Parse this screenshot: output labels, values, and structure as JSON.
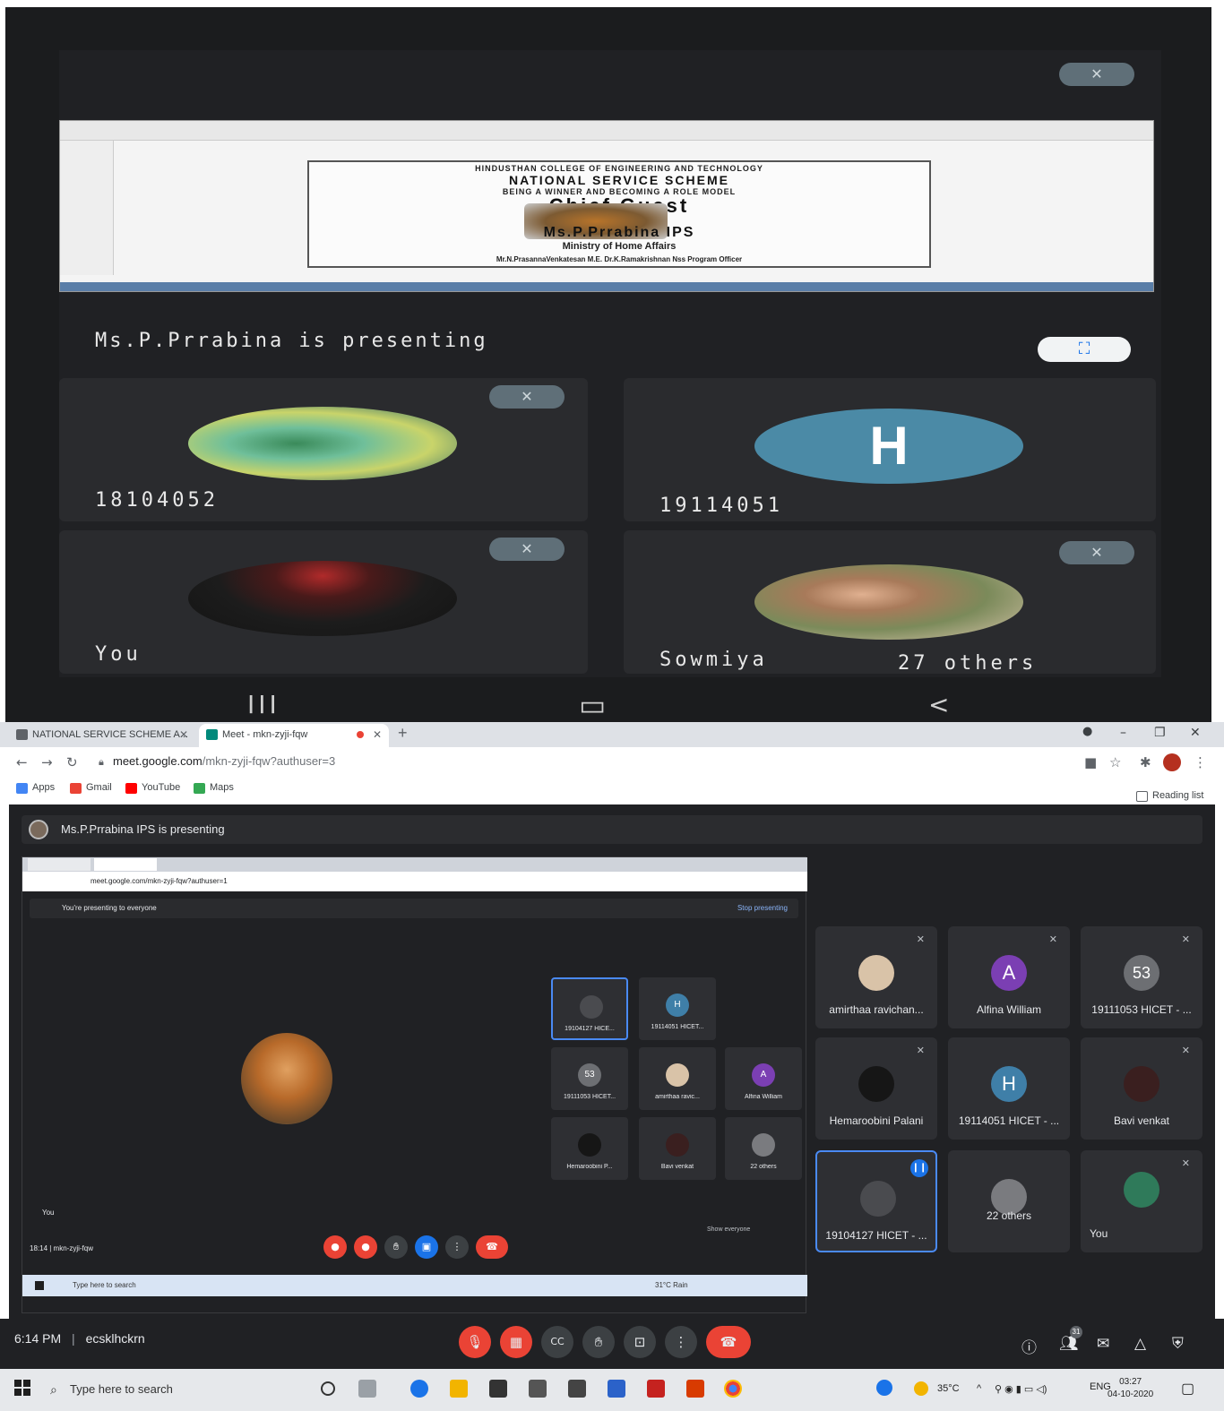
{
  "phone_view": {
    "presenting_text": "Ms.P.Prrabina is presenting",
    "shared_poster": {
      "line1": "HINDUSTHAN COLLEGE OF ENGINEERING AND TECHNOLOGY",
      "line2": "NATIONAL SERVICE SCHEME",
      "line3": "BEING A WINNER AND BECOMING A ROLE MODEL",
      "line4": "Chief Guest",
      "line5": "Ms.P.Prrabina IPS",
      "line6": "Ministry of Home Affairs",
      "line7": "Mr.N.PrasannaVenkatesan M.E.  Dr.K.Ramakrishnan  Nss Program Officer"
    },
    "tiles": [
      {
        "name": "18104052",
        "avatar": "photo-leaves"
      },
      {
        "name": "19114051",
        "initial": "H"
      },
      {
        "name": "You",
        "avatar": "photo-dark"
      },
      {
        "name": "Sowmiya",
        "extra": "27 others",
        "avatar": "photo-child"
      }
    ],
    "nav": {
      "recents": "III",
      "home": "▭",
      "back": "<"
    }
  },
  "browser": {
    "tabs": [
      {
        "title": "NATIONAL SERVICE SCHEME A...",
        "active": false
      },
      {
        "title": "Meet - mkn-zyji-fqw",
        "active": true
      }
    ],
    "new_tab": "+",
    "url_host": "meet.google.com",
    "url_path": "/mkn-zyji-fqw?authuser=3",
    "bookmarks": [
      "Apps",
      "Gmail",
      "YouTube",
      "Maps"
    ],
    "reading_list": "Reading list"
  },
  "meet": {
    "presenter_header": "Ms.P.Prrabina IPS is presenting",
    "inner": {
      "url": "meet.google.com/mkn-zyji-fqw?authuser=1",
      "banner": "You're presenting to everyone",
      "stop": "Stop presenting",
      "you_label": "You",
      "time_code": "18:14  |  mkn-zyji-fqw",
      "show_everyone": "Show everyone",
      "taskbar_search": "Type here to search",
      "taskbar_weather": "31°C Rain",
      "mini_tiles": [
        {
          "label": "19104127 HICE...",
          "speaking": true
        },
        {
          "label": "19114051 HICET...",
          "initial": "H"
        },
        {
          "label": "19111053 HICET...",
          "initial": "53"
        },
        {
          "label": "amirthaa ravic...",
          "initial": ""
        },
        {
          "label": "Alfina William",
          "initial": "A"
        },
        {
          "label": "Hemaroobini P...",
          "initial": ""
        },
        {
          "label": "Bavi venkat",
          "initial": ""
        },
        {
          "label": "22 others",
          "initial": ""
        }
      ]
    },
    "tiles": [
      {
        "label": "amirthaa ravichan...",
        "initial": "",
        "color": "#d9c3a8"
      },
      {
        "label": "Alfina William",
        "initial": "A",
        "color": "#7b3fb3"
      },
      {
        "label": "19111053 HICET - ...",
        "initial": "53",
        "color": "#6d6f73"
      },
      {
        "label": "Hemaroobini Palani",
        "initial": "",
        "color": "#161616"
      },
      {
        "label": "19114051 HICET - ...",
        "initial": "H",
        "color": "#3f7fa8"
      },
      {
        "label": "Bavi venkat",
        "initial": "",
        "color": "#3a1f1f"
      },
      {
        "label": "19104127 HICET - ...",
        "initial": "",
        "color": "#4a4b4f",
        "speaking": true
      },
      {
        "label": "22 others",
        "initial": "",
        "color": "#7a7b7f"
      },
      {
        "label": "You",
        "initial": "",
        "color": "#2f7a5a"
      }
    ],
    "bottom": {
      "time": "6:14 PM",
      "separator": "|",
      "meeting_code": "ecsklhckrn",
      "people_count": "31"
    }
  },
  "taskbar": {
    "search": "Type here to search",
    "weather": "35°C",
    "lang": "ENG",
    "time": "03:27",
    "date": "04-10-2020"
  },
  "colors": {
    "meet_bg": "#202124",
    "tile_bg": "#2e2f33",
    "speaking_border": "#4a8af4",
    "end_call": "#ea4335",
    "mute_red": "#ea4335"
  }
}
